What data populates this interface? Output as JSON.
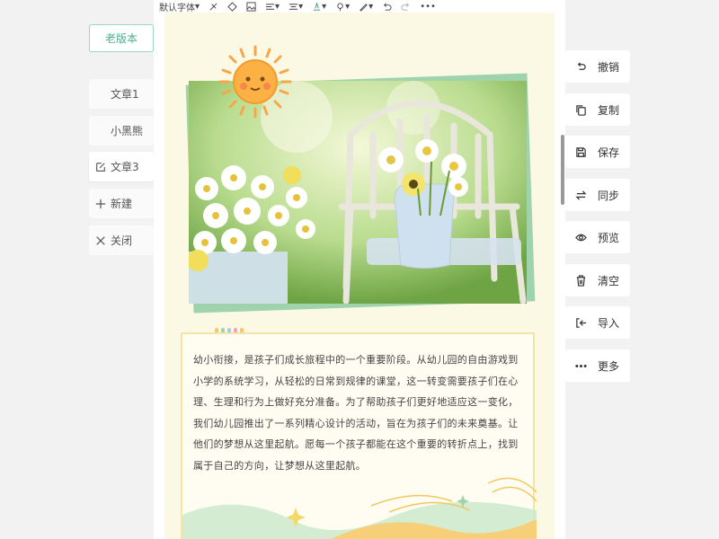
{
  "left_panel": {
    "old_version": "老版本",
    "items": [
      {
        "label": "文章1",
        "icon": ""
      },
      {
        "label": "小黑熊",
        "icon": ""
      },
      {
        "label": "文章3",
        "icon": "edit-icon"
      },
      {
        "label": "新建",
        "icon": "plus-icon"
      },
      {
        "label": "关闭",
        "icon": "close-icon"
      }
    ]
  },
  "toolbar": {
    "font_family": "默认字体"
  },
  "article": {
    "body": "幼小衔接，是孩子们成长旅程中的一个重要阶段。从幼儿园的自由游戏到小学的系统学习，从轻松的日常到规律的课堂，这一转变需要孩子们在心理、生理和行为上做好充分准备。为了帮助孩子们更好地适应这一变化，我们幼儿园推出了一系列精心设计的活动，旨在为孩子们的未来奠基。让他们的梦想从这里起航。愿每一个孩子都能在这个重要的转折点上，找到属于自己的方向，让梦想从这里起航。"
  },
  "right_panel": {
    "buttons": [
      {
        "label": "撤销",
        "icon": "undo-icon"
      },
      {
        "label": "复制",
        "icon": "copy-icon"
      },
      {
        "label": "保存",
        "icon": "save-icon"
      },
      {
        "label": "同步",
        "icon": "sync-icon"
      },
      {
        "label": "预览",
        "icon": "eye-icon"
      },
      {
        "label": "清空",
        "icon": "trash-icon"
      },
      {
        "label": "导入",
        "icon": "import-icon"
      },
      {
        "label": "更多",
        "icon": "more-icon"
      }
    ]
  },
  "colors": {
    "accent": "#4caf8c",
    "doc_bg": "#fbf8e3",
    "photo_frame": "#9fd3ac"
  }
}
